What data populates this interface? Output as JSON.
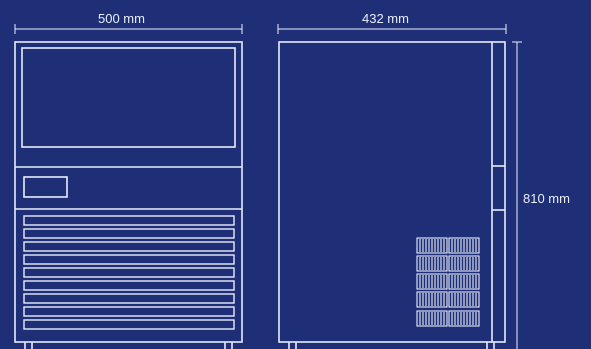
{
  "dimensions": {
    "front_width": "500 mm",
    "side_depth": "432 mm",
    "height": "810 mm"
  },
  "colors": {
    "background": "#1e2f78",
    "line": "#e9edf8"
  }
}
